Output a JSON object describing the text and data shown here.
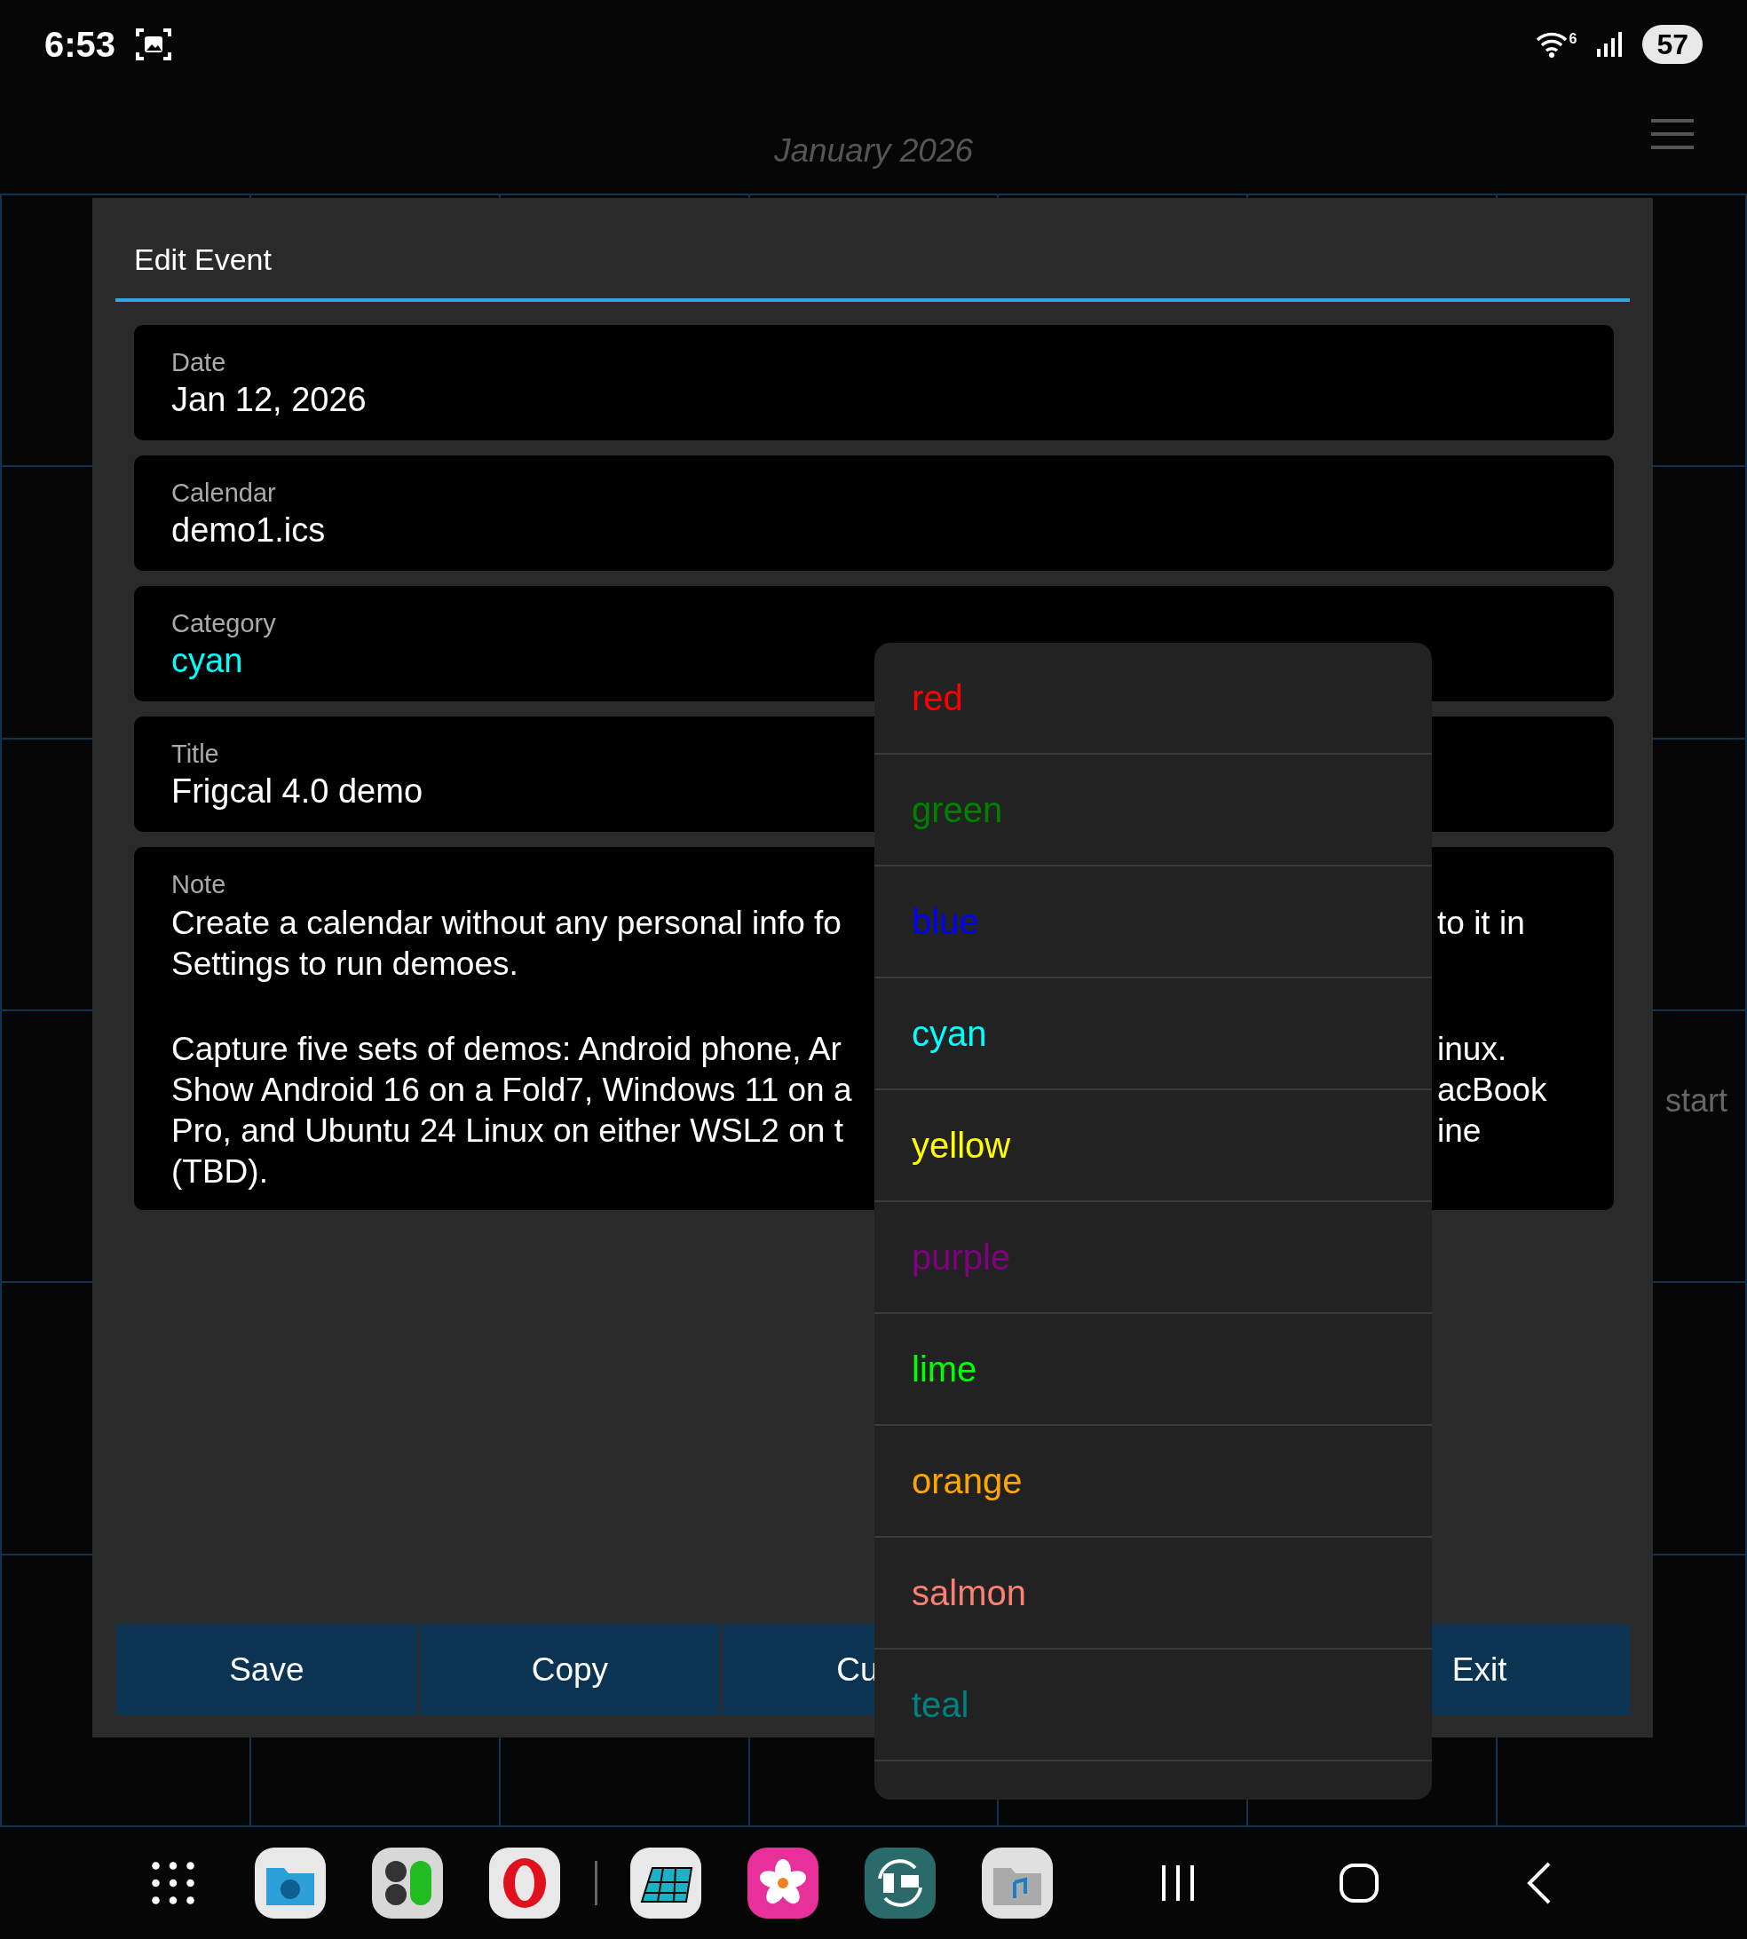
{
  "status_bar": {
    "time": "6:53",
    "wifi_label": "6",
    "battery": "57"
  },
  "header": {
    "title": "January 2026"
  },
  "calendar": {
    "partial_event_text": "start"
  },
  "dialog": {
    "title": "Edit Event",
    "fields": [
      {
        "label": "Date",
        "value": "Jan 12, 2026"
      },
      {
        "label": "Calendar",
        "value": "demo1.ics"
      },
      {
        "label": "Category",
        "value": "cyan",
        "color": "#00ffff"
      },
      {
        "label": "Title",
        "value": "Frigcal 4.0 demo"
      }
    ],
    "note": {
      "label": "Note",
      "lines": [
        {
          "left": "Create a calendar without any personal info fo",
          "right": "to it in"
        },
        {
          "left": "Settings to run demoes."
        },
        {
          "kind": "blank"
        },
        {
          "left": "Capture five sets of demos: Android phone, Ar",
          "right": "inux."
        },
        {
          "left": "Show Android 16 on a Fold7, Windows 11 on a",
          "right": "acBook"
        },
        {
          "left": "Pro, and Ubuntu 24 Linux on either WSL2 on t",
          "right": "ine"
        },
        {
          "left": "(TBD)."
        }
      ]
    },
    "buttons": [
      {
        "kind": "button",
        "label": "Save"
      },
      {
        "kind": "button",
        "label": "Copy"
      },
      {
        "kind": "button",
        "label": "Cu"
      },
      {
        "kind": "covered"
      },
      {
        "kind": "button",
        "label": "Exit"
      }
    ]
  },
  "dropdown": {
    "options": [
      {
        "label": "red",
        "color": "#ff0000"
      },
      {
        "label": "green",
        "color": "#008000"
      },
      {
        "label": "blue",
        "color": "#0000ff"
      },
      {
        "label": "cyan",
        "color": "#00ffff"
      },
      {
        "label": "yellow",
        "color": "#ffff00"
      },
      {
        "label": "purple",
        "color": "#800080"
      },
      {
        "label": "lime",
        "color": "#00ff00"
      },
      {
        "label": "orange",
        "color": "#ffa500"
      },
      {
        "label": "salmon",
        "color": "#fa8072"
      },
      {
        "label": "teal",
        "color": "#008080"
      }
    ]
  }
}
